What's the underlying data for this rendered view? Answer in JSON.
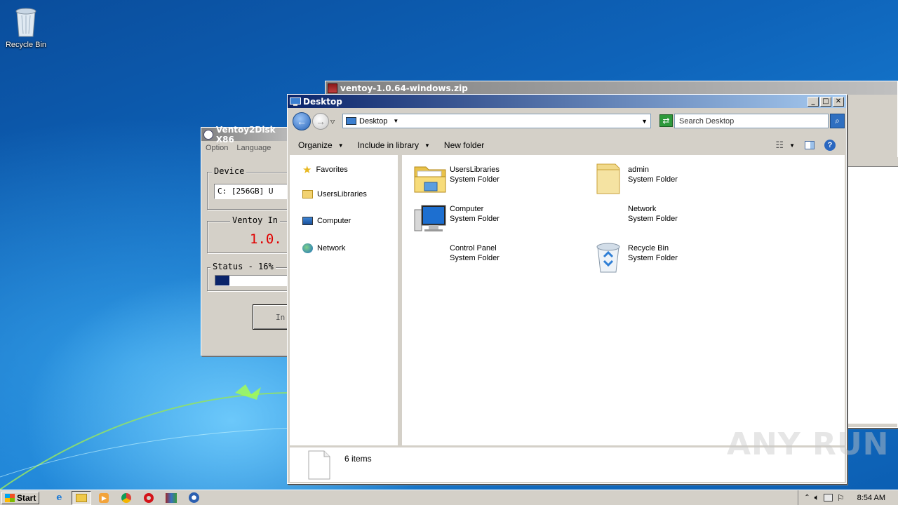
{
  "desktop": {
    "icons": [
      {
        "label": "Recycle Bin",
        "icon": "recycle-bin-icon"
      }
    ]
  },
  "zip_window": {
    "title": "ventoy-1.0.64-windows.zip"
  },
  "ventoy_window": {
    "title": "Ventoy2Disk  X86",
    "menu": [
      "Option",
      "Language"
    ],
    "device_label": "Device",
    "device_value": "C: [256GB]  U",
    "installed_label": "Ventoy In",
    "version": "1.0.",
    "status_label": "Status - 16%",
    "progress": 0.16,
    "button_label": "In",
    "version_color": "#e00000"
  },
  "explorer": {
    "title": "Desktop",
    "address": "Desktop",
    "search_placeholder": "Search Desktop",
    "toolbar": {
      "organize": "Organize",
      "include": "Include in library",
      "new_folder": "New folder"
    },
    "nav": [
      {
        "label": "Favorites",
        "icon": "star-icon"
      },
      {
        "label": "UsersLibraries",
        "icon": "library-folder-icon"
      },
      {
        "label": "Computer",
        "icon": "computer-icon"
      },
      {
        "label": "Network",
        "icon": "network-icon"
      }
    ],
    "items": [
      {
        "name": "UsersLibraries",
        "type": "System Folder",
        "icon": "library-folder-icon"
      },
      {
        "name": "admin",
        "type": "System Folder",
        "icon": "user-folder-icon"
      },
      {
        "name": "Computer",
        "type": "System Folder",
        "icon": "computer-icon"
      },
      {
        "name": "Network",
        "type": "System Folder",
        "icon": ""
      },
      {
        "name": "Control Panel",
        "type": "System Folder",
        "icon": ""
      },
      {
        "name": "Recycle Bin",
        "type": "System Folder",
        "icon": "recycle-bin-icon"
      }
    ],
    "status": "6 items"
  },
  "taskbar": {
    "start": "Start",
    "clock": "8:54 AM",
    "apps": [
      "ie-icon",
      "explorer-icon",
      "media-player-icon",
      "chrome-icon",
      "opera-icon",
      "winrar-icon",
      "ventoy-icon"
    ]
  },
  "watermark": "ANY RUN"
}
